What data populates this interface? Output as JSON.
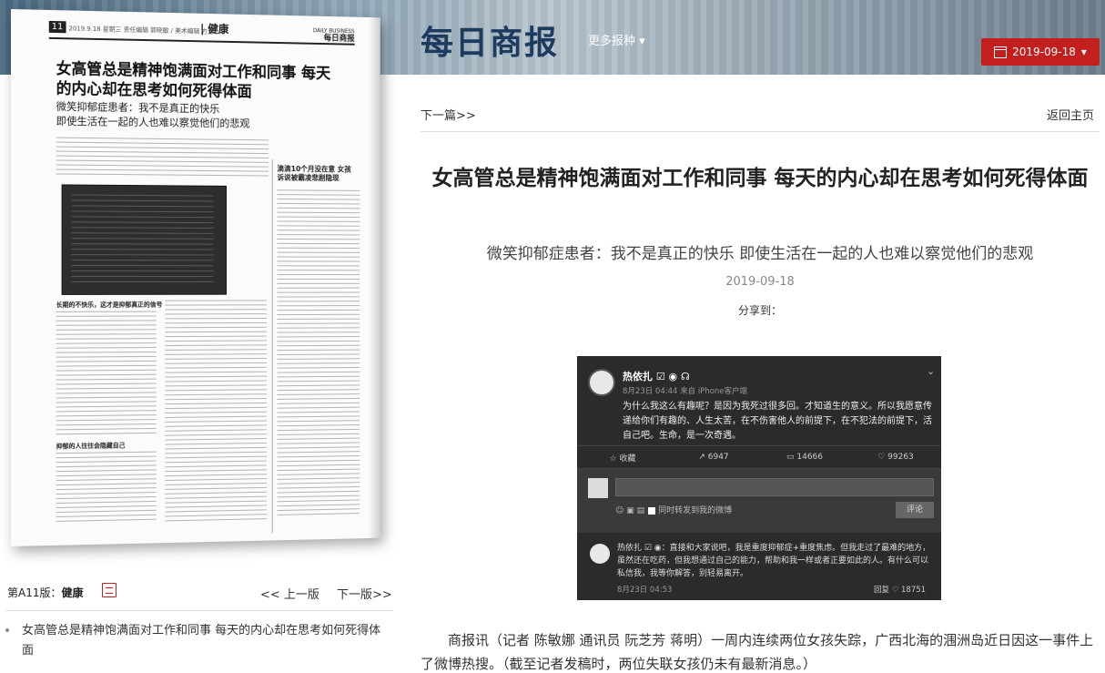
{
  "header": {
    "logo_text": "每日商报",
    "more_papers": "更多报种 ▾",
    "date_button": "2019-09-18",
    "date_caret": "▾"
  },
  "newspaper_page": {
    "page_number": "11",
    "meta_line": "2019.9.18 星期三  责任编辑 郭晓敏 / 美术编辑 方芳",
    "section": "| 健康",
    "brand_en": "DAILY BUSINESS",
    "brand_cn": "每日商报",
    "headline": "女高管总是精神饱满面对工作和同事 每天的内心却在思考如何死得体面",
    "subheadline_1": "微笑抑郁症患者：我不是真正的快乐",
    "subheadline_2": "即使生活在一起的人也难以察觉他们的悲观",
    "side_title": "滴滴10个月没在意 女孩诉说被霸凌悲剧隐现",
    "section_head_1": "长期的不快乐，这才是抑郁真正的信号",
    "section_head_2": "抑郁的人往往会隐藏自己"
  },
  "left_footer": {
    "edition_label": "第A11版：",
    "edition_name": "健康",
    "pdf_icon": "pdf-icon",
    "prev_label": "<< 上一版",
    "next_label": "下一版>>",
    "article_list": [
      "女高管总是精神饱满面对工作和同事 每天的内心却在思考如何死得体面"
    ]
  },
  "article": {
    "next_link": "下一篇>>",
    "home_link": "返回主页",
    "title": "女高管总是精神饱满面对工作和同事 每天的内心却在思考如何死得体面",
    "subtitle": "微笑抑郁症患者：我不是真正的快乐 即使生活在一起的人也难以察觉他们的悲观",
    "date": "2019-09-18",
    "share_label": "分享到：",
    "body_first": "商报讯（记者 陈敏娜 通讯员 阮芝芳 蒋明）一周内连续两位女孩失踪，广西北海的涠洲岛近日因这一事件上了微博热搜。（截至记者发稿时，两位失联女孩仍未有最新消息。）"
  },
  "weibo": {
    "user_name": "热依扎 ☑ ◉ ☊",
    "meta": "8月23日 04:44 来自 iPhone客户端",
    "post_text": "为什么我这么有趣呢？是因为我死过很多回。才知道生的意义。所以我愿意传递给你们有趣的、人生太苦，在不伤害他人的前提下，在不犯法的前提下，活自己吧。生命，是一次奇遇。",
    "actions": [
      "☆ 收藏",
      "↗ 6947",
      "▭ 14666",
      "♡ 99263"
    ],
    "tools": "☺  ▣  ▤",
    "repost_option": "同时转发到我的微博",
    "submit_label": "评论",
    "reply_text": "热依扎 ☑ ◉：直接和大家说吧，我是重度抑郁症+重度焦虑。但我走过了最难的地方，虽然还在吃药，但我想通过自己的能力，帮助和我一样或者正要如此的人。有什么可以私信我，我等你解答，别轻易离开。",
    "reply_time": "8月23日 04:53",
    "reply_stats": "回复   ♡ 18751"
  }
}
